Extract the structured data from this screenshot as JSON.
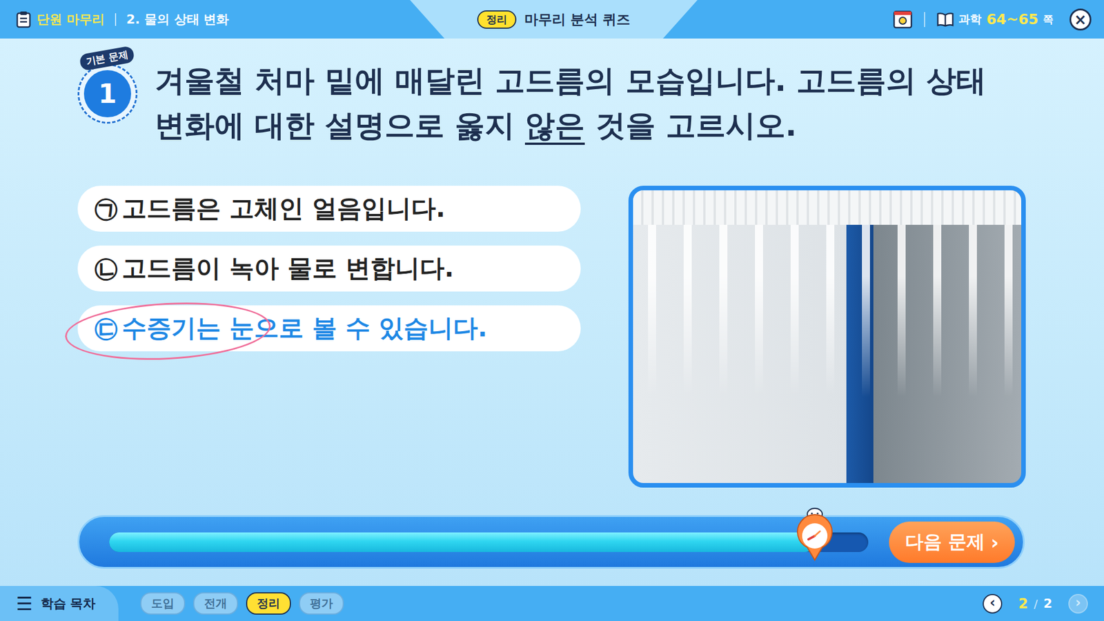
{
  "header": {
    "section": "단원 마무리",
    "unit": "2. 물의 상태 변화",
    "stage_badge": "정리",
    "title": "마무리 분석 퀴즈",
    "textbook": "과학",
    "pages": "64~65",
    "pages_unit": "쪽",
    "close": "×"
  },
  "question": {
    "badge": "기본 문제",
    "number": "1",
    "text_before": "겨울철 처마 밑에 매달린 고드름의 모습입니다. 고드름의 상태 변화에 대한 설명으로 옳지 ",
    "text_emphasis": "않은",
    "text_after": " 것을 고르시오."
  },
  "options": [
    {
      "mark": "㉠",
      "text": "고드름은 고체인 얼음입니다.",
      "selected": false
    },
    {
      "mark": "㉡",
      "text": "고드름이 녹아 물로 변합니다.",
      "selected": false
    },
    {
      "mark": "㉢",
      "text": "수증기는 눈으로 볼 수 있습니다.",
      "selected": true
    }
  ],
  "timer": {
    "level": 0.93
  },
  "next_button": {
    "label": "다음 문제",
    "arrow": "›"
  },
  "footer": {
    "menu_icon": "☰",
    "menu_label": "학습 목차",
    "steps": [
      {
        "label": "도입",
        "selected": false
      },
      {
        "label": "전개",
        "selected": false
      },
      {
        "label": "정리",
        "selected": true
      },
      {
        "label": "평가",
        "selected": false
      }
    ],
    "prev": "‹",
    "page_current": "2",
    "page_separator": "/",
    "page_total": "2",
    "next": "›",
    "next_disabled": true
  }
}
